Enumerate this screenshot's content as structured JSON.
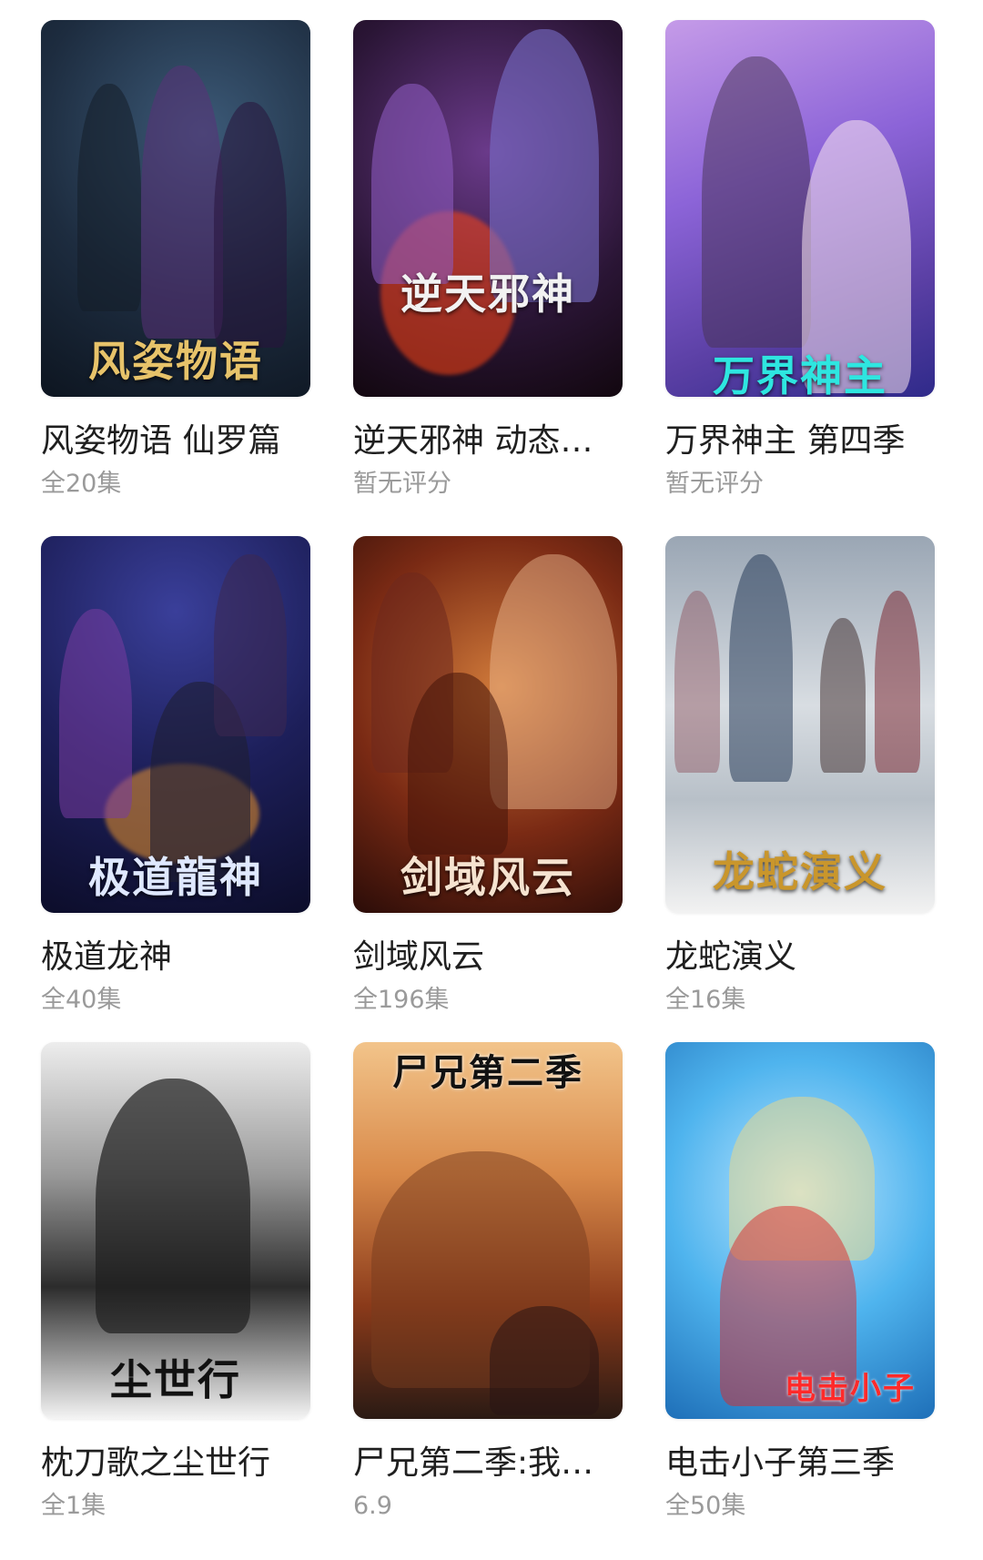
{
  "items": [
    {
      "title": "风姿物语 仙罗篇",
      "subtitle": "全20集",
      "poster_text": "风姿物语",
      "poster_text_color": "#e7c36a"
    },
    {
      "title": "逆天邪神 动态…",
      "subtitle": "暂无评分",
      "poster_text": "逆天邪神",
      "poster_text_color": "#f2f2f2"
    },
    {
      "title": "万界神主 第四季",
      "subtitle": "暂无评分",
      "poster_text": "万界神主",
      "poster_text_color": "#2ee6e0"
    },
    {
      "title": "极道龙神",
      "subtitle": "全40集",
      "poster_text": "极道龍神",
      "poster_text_color": "#dfe8ff"
    },
    {
      "title": "剑域风云",
      "subtitle": "全196集",
      "poster_text": "剑域风云",
      "poster_text_color": "#f6e3d0"
    },
    {
      "title": "龙蛇演义",
      "subtitle": "全16集",
      "poster_text": "龙蛇演义",
      "poster_text_color": "#c9962c"
    },
    {
      "title": "枕刀歌之尘世行",
      "subtitle": "全1集",
      "poster_text": "尘世行",
      "poster_text_color": "#111111"
    },
    {
      "title": "尸兄第二季:我…",
      "subtitle": "6.9",
      "poster_text": "尸兄第二季",
      "poster_text_color": "#111111"
    },
    {
      "title": "电击小子第三季",
      "subtitle": "全50集",
      "poster_text": "电击小子",
      "poster_text_color": "#ff2a2a"
    }
  ]
}
